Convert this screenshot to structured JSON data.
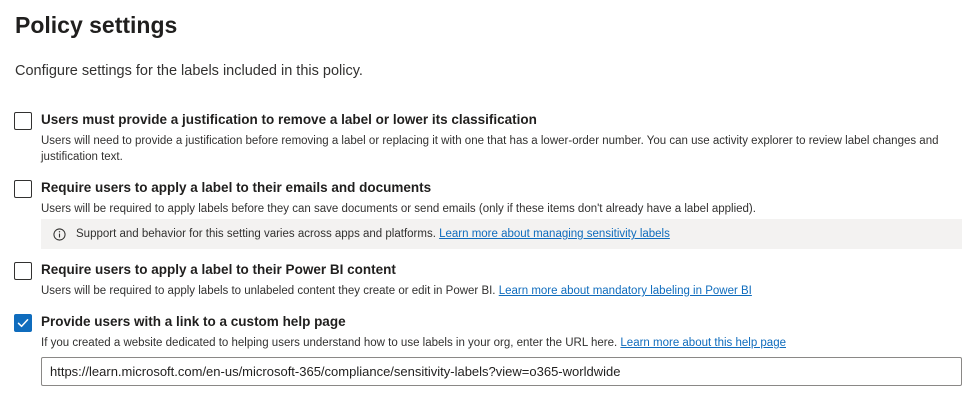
{
  "page": {
    "title": "Policy settings",
    "subtitle": "Configure settings for the labels included in this policy."
  },
  "settings": [
    {
      "checked": false,
      "title": "Users must provide a justification to remove a label or lower its classification",
      "description": "Users will need to provide a justification before removing a label or replacing it with one that has a lower-order number. You can use activity explorer to review label changes and justification text."
    },
    {
      "checked": false,
      "title": "Require users to apply a label to their emails and documents",
      "description": "Users will be required to apply labels before they can save documents or send emails (only if these items don't already have a label applied).",
      "info": {
        "icon": "info-icon",
        "text": "Support and behavior for this setting varies across apps and platforms.",
        "link": "Learn more about managing sensitivity labels"
      }
    },
    {
      "checked": false,
      "title": "Require users to apply a label to their Power BI content",
      "description": "Users will be required to apply labels to unlabeled content they create or edit in Power BI.",
      "link": "Learn more about mandatory labeling in Power BI"
    },
    {
      "checked": true,
      "title": "Provide users with a link to a custom help page",
      "description": "If you created a website dedicated to helping users understand how to use labels in your org, enter the URL here.",
      "link": "Learn more about this help page",
      "url_value": "https://learn.microsoft.com/en-us/microsoft-365/compliance/sensitivity-labels?view=o365-worldwide"
    }
  ],
  "colors": {
    "accent": "#0f6cbd",
    "info_background": "#f3f2f1"
  }
}
